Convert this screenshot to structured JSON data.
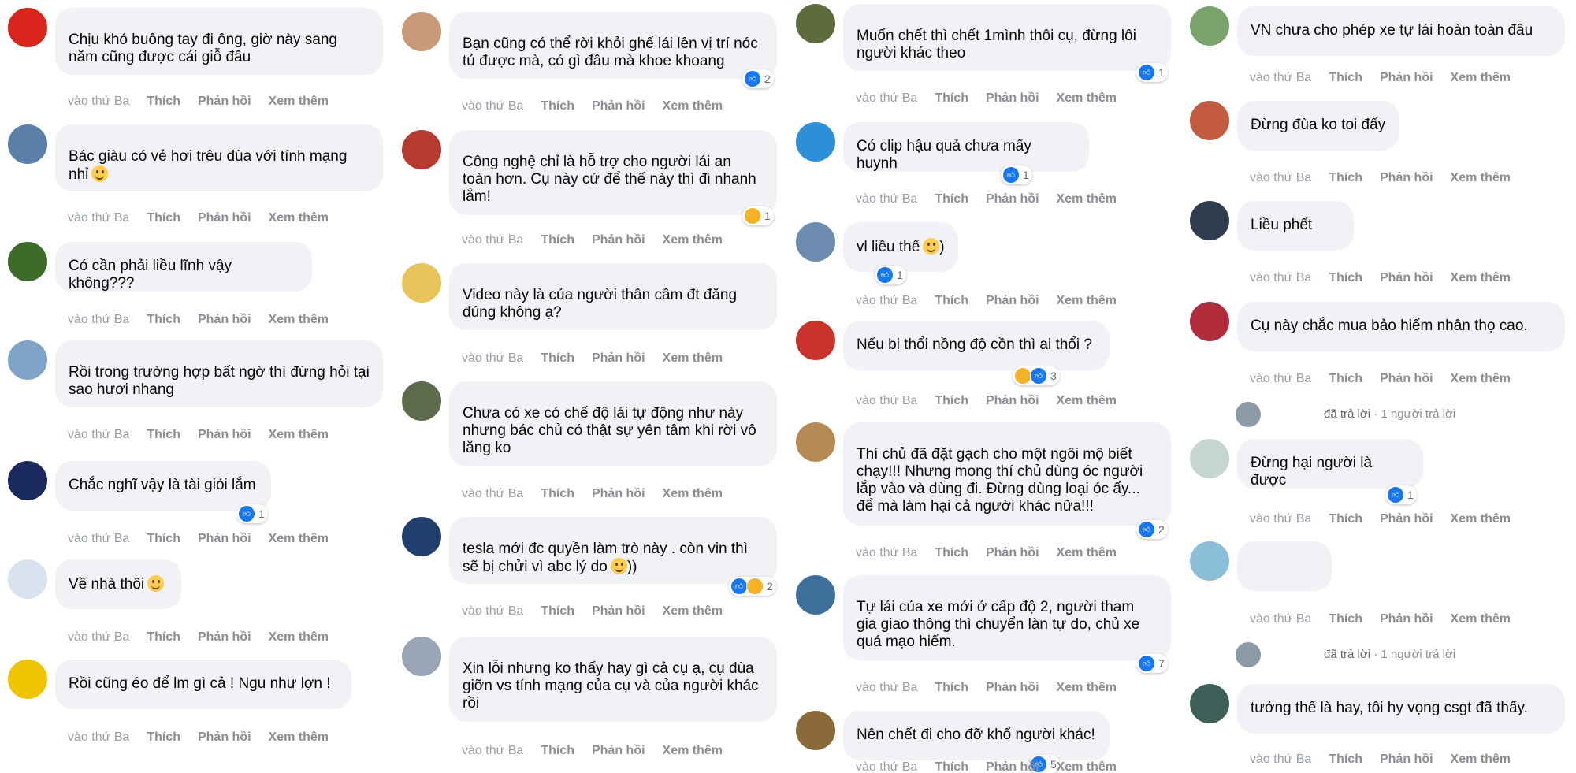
{
  "actions": {
    "time": "vào thứ Ba",
    "like": "Thích",
    "reply": "Phản hồi",
    "more": "Xem thêm"
  },
  "reply_summary": {
    "replied": "đã trả lời",
    "count_text": "· 1 người trả lời"
  },
  "columns": [
    {
      "comments": [
        {
          "text": "Chịu khó buông tay đi ông, giờ này sang năm cũng được cái giỗ đầu",
          "reactions": null
        },
        {
          "text": "Bác giàu có vẻ hơi trêu đùa với tính mạng nhỉ",
          "emoji": "laughing-emoji",
          "reactions": null
        },
        {
          "text": "Có cần phải liều lĩnh vậy không???",
          "reactions": null
        },
        {
          "text": "Rồi trong trường hợp bất ngờ thì đừng hỏi tại sao hươi nhang",
          "reactions": null
        },
        {
          "text": "Chắc nghĩ vậy là tài giỏi lắm",
          "reactions": {
            "icons": [
              "like"
            ],
            "count": "1"
          }
        },
        {
          "text": "Về nhà thôi",
          "emoji": "grinning-emoji",
          "reactions": null
        },
        {
          "text": "Rồi cũng éo để lm gì cả ! Ngu như lợn !",
          "reactions": null
        }
      ]
    },
    {
      "comments": [
        {
          "text": "Bạn cũng có thể rời khỏi ghế lái lên vị trí nóc tủ được mà, có gì đâu mà khoe khoang",
          "reactions": {
            "icons": [
              "like"
            ],
            "count": "2"
          }
        },
        {
          "text": "Công nghệ chỉ là hỗ trợ cho người lái an toàn hơn. Cụ này cứ để thế này thì đi nhanh lắm!",
          "reactions": {
            "icons": [
              "wow"
            ],
            "count": "1"
          }
        },
        {
          "text": "Video này là của người thân cầm đt đăng đúng không ạ?",
          "reactions": null
        },
        {
          "text": "Chưa có xe có chế độ lái tự động như này nhưng bác chủ có thật sự yên tâm khi rời vô lăng ko",
          "reactions": null
        },
        {
          "text": "tesla mới đc quyền làm trò này . còn vin thì sẽ bị chửi vì abc lý do",
          "emoji": "smiling-emoji",
          "text_after": "))",
          "reactions": {
            "icons": [
              "like",
              "haha"
            ],
            "count": "2"
          }
        },
        {
          "text": "Xin lỗi nhưng ko thấy hay gì cả cụ ạ, cụ đùa giỡn vs tính mạng của cụ và của người khác rồi",
          "reactions": null
        }
      ]
    },
    {
      "comments": [
        {
          "text": "Muốn chết thì chết 1mình thôi cụ, đừng lôi người khác theo",
          "reactions": {
            "icons": [
              "like"
            ],
            "count": "1"
          }
        },
        {
          "text": "Có clip hậu quả chưa mấy huynh",
          "reactions": {
            "icons": [
              "like"
            ],
            "count": "1"
          }
        },
        {
          "text": "vl liều thế",
          "emoji": "smiling-emoji",
          "text_after": ")",
          "reactions": {
            "icons": [
              "like"
            ],
            "count": "1"
          }
        },
        {
          "text": "Nếu bị thổi nồng độ cồn thì ai thổi ?",
          "reactions": {
            "icons": [
              "haha",
              "like"
            ],
            "count": "3"
          }
        },
        {
          "text": "Thí chủ đã đặt gạch cho một ngôi mộ biết chạy!!! Nhưng mong thí chủ dùng óc người lắp vào và dùng đi. Đừng dùng loại óc ấy... để mà làm hại cả người khác nữa!!!",
          "reactions": {
            "icons": [
              "like"
            ],
            "count": "2"
          }
        },
        {
          "text": "Tự lái của xe mới ở cấp độ 2, người tham gia giao thông thì chuyển làn tự do, chủ xe quá mạo hiểm.",
          "reactions": {
            "icons": [
              "like"
            ],
            "count": "7"
          }
        },
        {
          "text": "Nên chết đi cho đỡ khổ người khác!",
          "reactions": {
            "icons": [
              "like"
            ],
            "count": "5"
          }
        }
      ]
    },
    {
      "comments": [
        {
          "text": "VN chưa cho phép xe tự lái hoàn toàn đâu",
          "reactions": null
        },
        {
          "text": "Đừng đùa ko toi đấy",
          "reactions": null
        },
        {
          "text": "Liều phết",
          "reactions": null
        },
        {
          "text": "Cụ này chắc mua bảo hiểm nhân thọ cao.",
          "reactions": null
        },
        {
          "text": "Đừng hại người là được",
          "reactions": {
            "icons": [
              "like"
            ],
            "count": "1"
          }
        },
        {
          "text": "",
          "reactions": null
        },
        {
          "text": "tưởng thế là hay, tôi hy vọng csgt đã thấy.",
          "reactions": null
        }
      ]
    }
  ],
  "colors": {
    "bubble": "#f0f2f5",
    "like_blue": "#1877f2",
    "muted": "#8a8d91"
  }
}
